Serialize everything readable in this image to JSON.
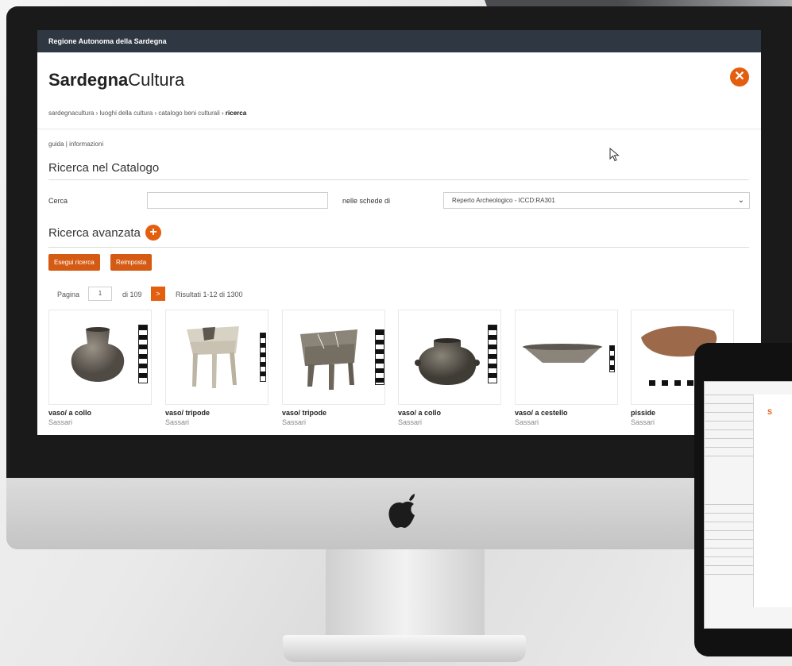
{
  "topbar": {
    "region": "Regione Autonoma della Sardegna"
  },
  "brand": {
    "part1": "Sardegna",
    "part2": "Cultura"
  },
  "breadcrumb": {
    "items": [
      "sardegnacultura",
      "luoghi della cultura",
      "catalogo beni culturali"
    ],
    "separator": "›",
    "current": "ricerca"
  },
  "guide": "guida | informazioni",
  "search": {
    "title": "Ricerca nel Catalogo",
    "label": "Cerca",
    "value": "",
    "schede_label": "nelle schede di",
    "schede_value": "Reperto Archeologico - ICCD:RA301"
  },
  "advanced": {
    "title": "Ricerca avanzata"
  },
  "buttons": {
    "search": "Esegui ricerca",
    "reset": "Reimposta"
  },
  "pagination": {
    "label": "Pagina",
    "current": "1",
    "of": "di 109",
    "next": ">",
    "results": "Risultati 1-12 di 1300"
  },
  "results": [
    {
      "title": "vaso/ a collo",
      "place": "Sassari"
    },
    {
      "title": "vaso/ tripode",
      "place": "Sassari"
    },
    {
      "title": "vaso/ tripode",
      "place": "Sassari"
    },
    {
      "title": "vaso/ a collo",
      "place": "Sassari"
    },
    {
      "title": "vaso/ a cestello",
      "place": "Sassari"
    },
    {
      "title": "pisside",
      "place": "Sassari"
    }
  ],
  "icons": {
    "close": "close-icon",
    "plus": "plus-icon",
    "cursor": "cursor-icon",
    "chevron": "chevron-down-icon",
    "apple": "apple-logo-icon"
  },
  "colors": {
    "accent": "#e35f0f",
    "topbar": "#2f3842"
  }
}
